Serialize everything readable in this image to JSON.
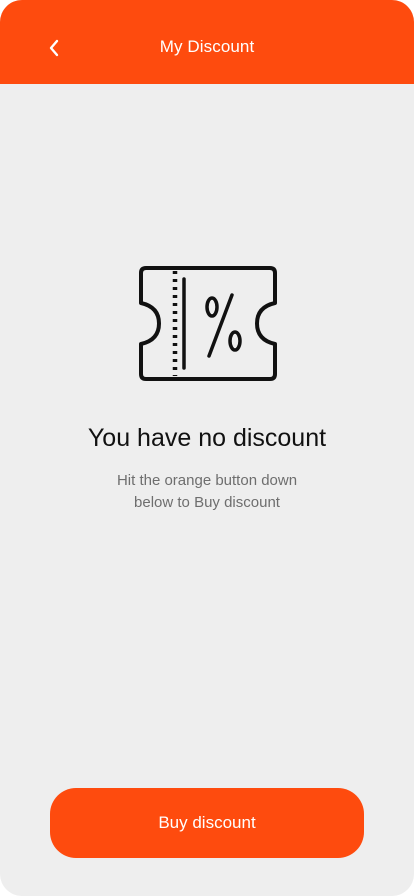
{
  "header": {
    "title": "My Discount",
    "back_icon": "chevron-left-icon"
  },
  "empty_state": {
    "icon": "discount-ticket-icon",
    "heading": "You have no discount",
    "message_line1": "Hit the orange button down",
    "message_line2": "below to Buy discount"
  },
  "actions": {
    "buy_label": "Buy discount"
  },
  "colors": {
    "accent": "#fe4b0e",
    "background": "#eeeeee",
    "heading": "#111111",
    "message": "#6e6e6e"
  }
}
